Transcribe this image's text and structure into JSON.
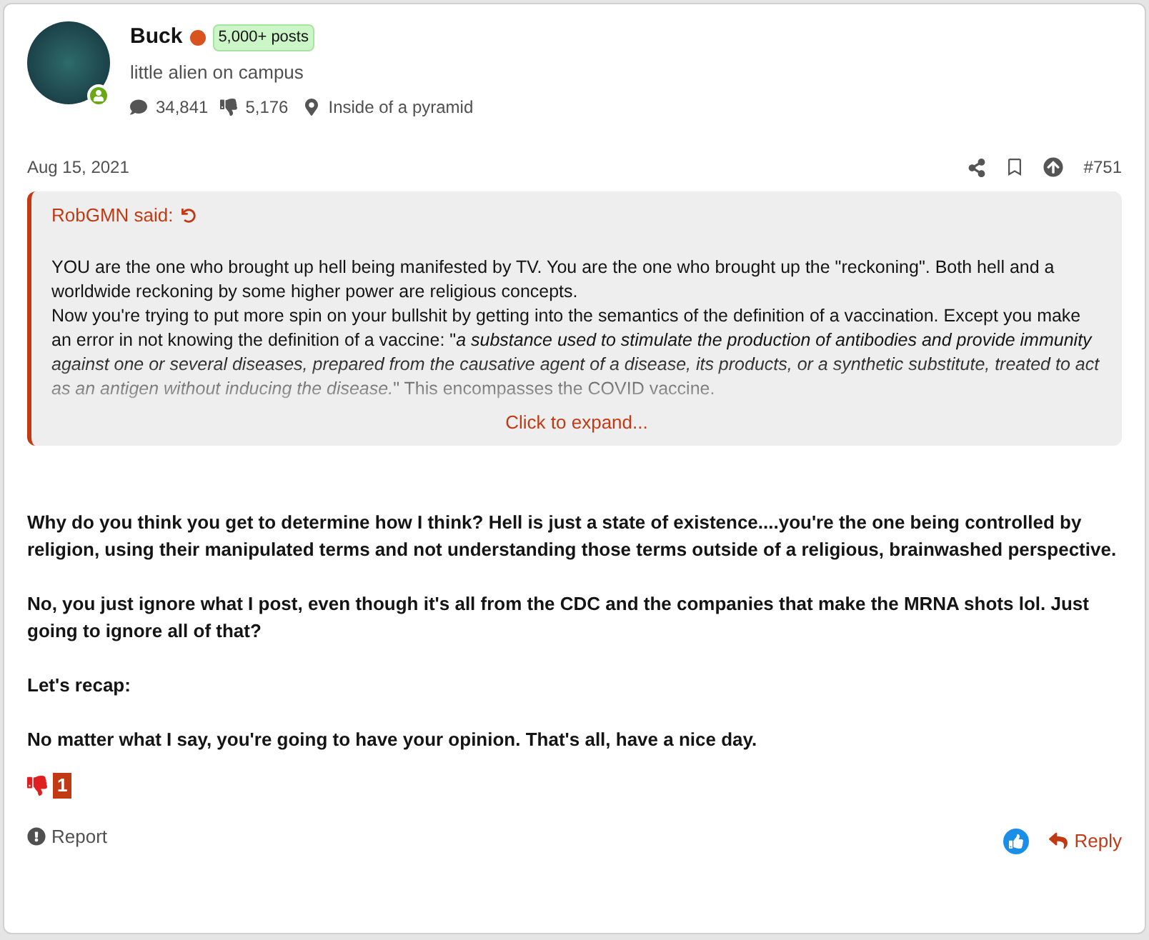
{
  "author": {
    "name": "Buck",
    "badge": "5,000+ posts",
    "title": "little alien on campus",
    "messages": "34,841",
    "reactions": "5,176",
    "location": "Inside of a pyramid",
    "online": true
  },
  "post": {
    "date": "Aug 15, 2021",
    "number": "#751"
  },
  "quote": {
    "author": "RobGMN said:",
    "paragraphs": [
      "YOU are the one who brought up hell being manifested by TV. You are the one who brought up the \"reckoning\". Both hell and a worldwide reckoning by some higher power are religious concepts.",
      "Now you're trying to put more spin on your bullshit by getting into the semantics of the definition of a vaccination. Except you make an error in not knowing the definition of a vaccine: \"*a substance used to stimulate the production of antibodies and provide immunity against one or several diseases, prepared from the causative agent of a disease, its products, or a synthetic substitute, treated to act as an antigen without inducing the disease.*\" This encompasses the COVID vaccine."
    ],
    "expand": "Click to expand..."
  },
  "body": [
    "Why do you think you get to determine how I think? Hell is just a state of existence....you're the one being controlled by religion, using their manipulated terms and not understanding those terms outside of a religious, brainwashed perspective.",
    "No, you just ignore what I post, even though it's all from the CDC and the companies that make the MRNA shots lol. Just going to ignore all of that?",
    "Let's recap:",
    "No matter what I say, you're going to have your opinion. That's all, have a nice day."
  ],
  "reaction_count": "1",
  "actions": {
    "report": "Report",
    "reply": "Reply"
  }
}
